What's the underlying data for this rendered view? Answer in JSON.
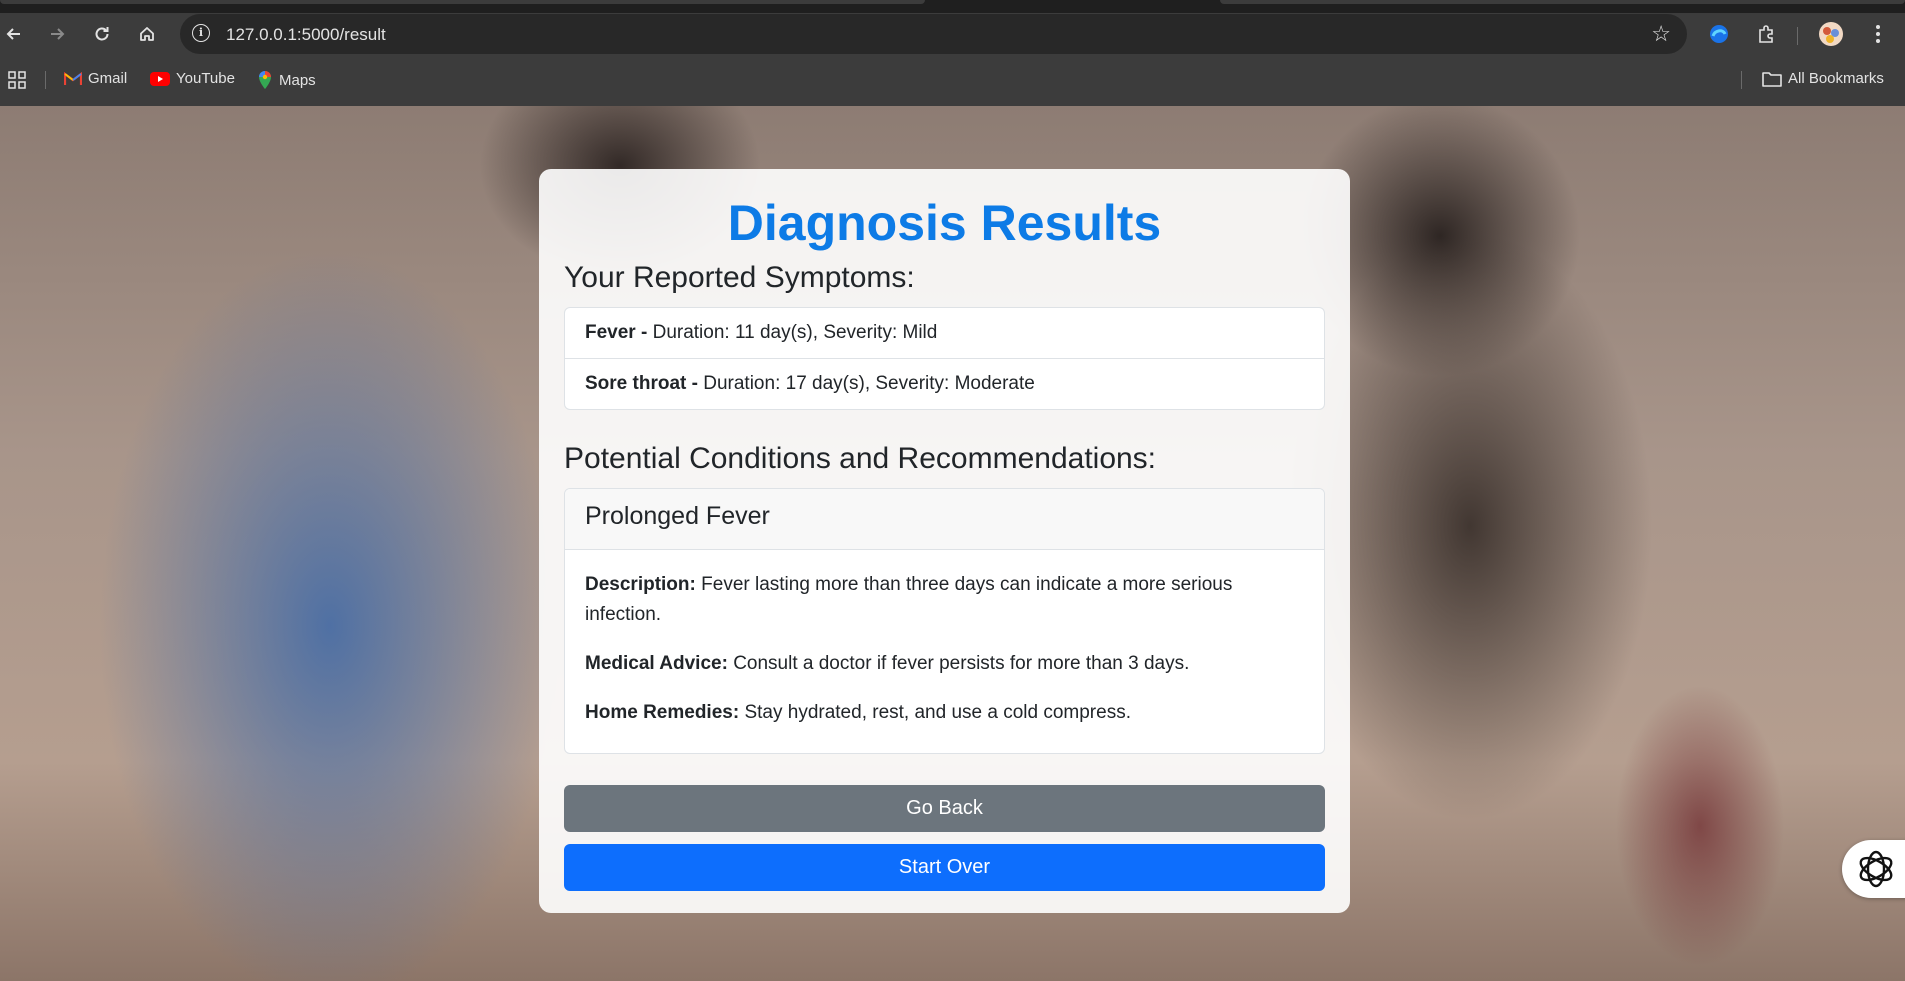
{
  "browser": {
    "url": "127.0.0.1:5000/result",
    "bookmarks": [
      {
        "label": "Gmail",
        "icon": "gmail-icon"
      },
      {
        "label": "YouTube",
        "icon": "youtube-icon"
      },
      {
        "label": "Maps",
        "icon": "maps-icon"
      }
    ],
    "all_bookmarks_label": "All Bookmarks"
  },
  "page": {
    "title": "Diagnosis Results",
    "symptoms_heading": "Your Reported Symptoms:",
    "symptoms": [
      {
        "name": "Fever",
        "separator": " - ",
        "details": "Duration: 11 day(s), Severity: Mild"
      },
      {
        "name": "Sore throat",
        "separator": " - ",
        "details": "Duration: 17 day(s), Severity: Moderate"
      }
    ],
    "conditions_heading": "Potential Conditions and Recommendations:",
    "conditions": [
      {
        "name": "Prolonged Fever",
        "description_label": "Description:",
        "description": "Fever lasting more than three days can indicate a more serious infection.",
        "advice_label": "Medical Advice:",
        "advice": "Consult a doctor if fever persists for more than 3 days.",
        "remedies_label": "Home Remedies:",
        "remedies": "Stay hydrated, rest, and use a cold compress."
      }
    ],
    "go_back_label": "Go Back",
    "start_over_label": "Start Over"
  },
  "colors": {
    "title": "#0d7be6",
    "go_back": "#6c757d",
    "start_over": "#0d6efd"
  }
}
